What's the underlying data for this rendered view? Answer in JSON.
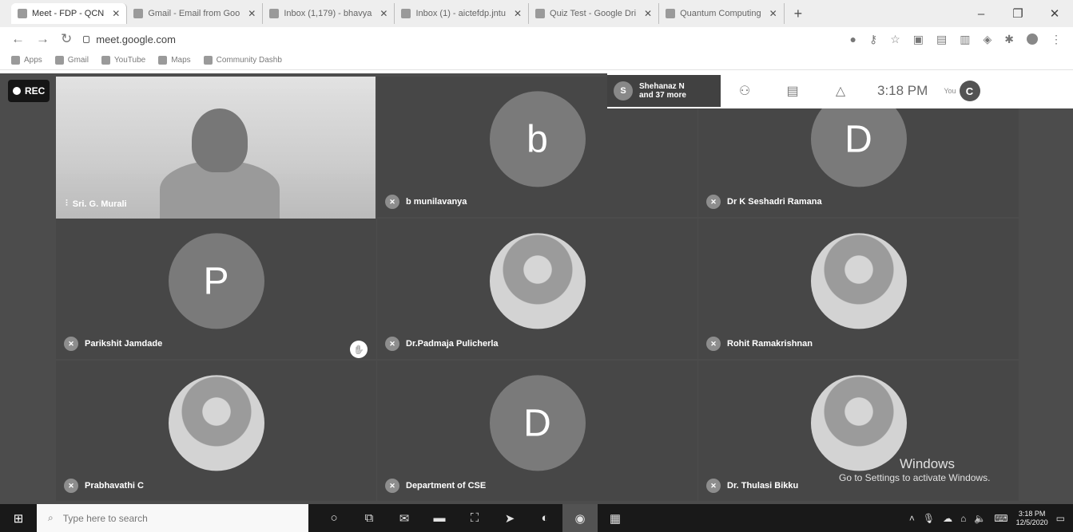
{
  "browser": {
    "tabs": [
      {
        "label": "Meet - FDP - QCN"
      },
      {
        "label": "Gmail - Email from Goo"
      },
      {
        "label": "Inbox (1,179) - bhavya"
      },
      {
        "label": "Inbox (1) - aictefdp.jntu"
      },
      {
        "label": "Quiz Test - Google Dri"
      },
      {
        "label": "Quantum Computing"
      }
    ],
    "new_tab": "+",
    "url": "meet.google.com",
    "bookmarks": [
      "Apps",
      "Gmail",
      "YouTube",
      "Maps",
      "Community Dashb"
    ]
  },
  "meet": {
    "rec_label": "REC",
    "participants_avatar": "S",
    "participants_line1": "Shehanaz N",
    "participants_line2": "and 37 more",
    "clock": "3:18 PM",
    "you_label": "You",
    "self_initial": "C",
    "tiles": [
      {
        "name": "Sri. G. Murali",
        "type": "video"
      },
      {
        "name": "b munilavanya",
        "initial": "b"
      },
      {
        "name": "Dr K Seshadri Ramana",
        "initial": "D"
      },
      {
        "name": "Parikshit Jamdade",
        "initial": "P"
      },
      {
        "name": "Dr.Padmaja Pulicherla",
        "initial": ""
      },
      {
        "name": "Rohit Ramakrishnan",
        "initial": ""
      },
      {
        "name": "Prabhavathi C",
        "initial": ""
      },
      {
        "name": "Department of CSE",
        "initial": "D"
      },
      {
        "name": "Dr. Thulasi Bikku",
        "initial": ""
      }
    ],
    "watermark_line1": "Windows",
    "watermark_line2": "Go to Settings to activate Windows."
  },
  "taskbar": {
    "search_placeholder": "Type here to search",
    "time": "3:18 PM",
    "date": "12/5/2020"
  }
}
